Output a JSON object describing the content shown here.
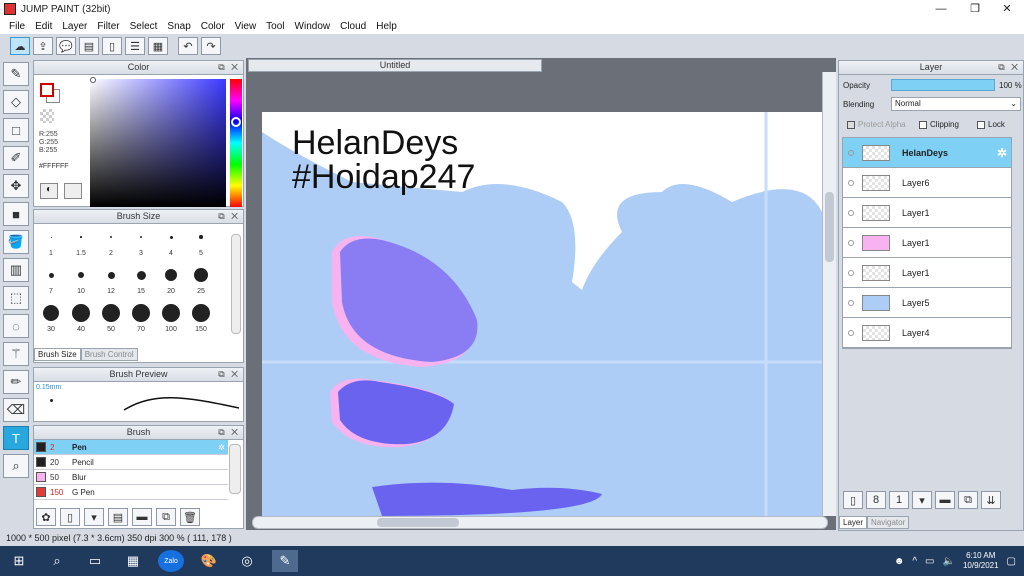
{
  "window": {
    "title": "JUMP PAINT (32bit)",
    "minimize": "—",
    "restore": "❐",
    "close": "✕"
  },
  "menu": [
    "File",
    "Edit",
    "Layer",
    "Filter",
    "Select",
    "Snap",
    "Color",
    "View",
    "Tool",
    "Window",
    "Cloud",
    "Help"
  ],
  "color_panel": {
    "title": "Color",
    "r": "R:255",
    "g": "G:255",
    "b": "B:255",
    "hex": "#FFFFFF"
  },
  "brush_size_panel": {
    "title": "Brush Size",
    "sizes": [
      "1",
      "1.5",
      "2",
      "3",
      "4",
      "5",
      "7",
      "10",
      "12",
      "15",
      "20",
      "25",
      "30",
      "40",
      "50",
      "70",
      "100",
      "150"
    ],
    "tab_active": "Brush Size",
    "tab_inactive": "Brush Control"
  },
  "brush_preview_panel": {
    "title": "Brush Preview",
    "size": "0.15mm"
  },
  "brush_panel": {
    "title": "Brush",
    "brushes": [
      {
        "size": "2",
        "name": "Pen",
        "color": "#222222"
      },
      {
        "size": "20",
        "name": "Pencil",
        "color": "#222222"
      },
      {
        "size": "50",
        "name": "Blur",
        "color": "#f6b3f0"
      },
      {
        "size": "150",
        "name": "G Pen",
        "color": "#e33b3b"
      }
    ]
  },
  "document": {
    "tab": "Untitled",
    "text_line1": "HelanDeys",
    "text_line2": "#Hoidap247",
    "colors": {
      "sky": "#aecdf6",
      "blob": "#6a63f0",
      "pink": "#f6b3f0"
    }
  },
  "layer_panel": {
    "title": "Layer",
    "opacity_label": "Opacity",
    "opacity_value": "100 %",
    "blending_label": "Blending",
    "blending_value": "Normal",
    "protect_alpha": "Protect Alpha",
    "clipping": "Clipping",
    "lock": "Lock",
    "layers": [
      "HelanDeys",
      "Layer6",
      "Layer1",
      "Layer1",
      "Layer1",
      "Layer5",
      "Layer4"
    ],
    "tab_active": "Layer",
    "tab_inactive": "Navigator"
  },
  "status": {
    "text": "1000 * 500 pixel   (7.3 * 3.6cm)   350 dpi   300 %   ( 111, 178 )"
  },
  "taskbar": {
    "time": "6:10 AM",
    "date": "10/9/2021",
    "zalo": "Zalo"
  }
}
